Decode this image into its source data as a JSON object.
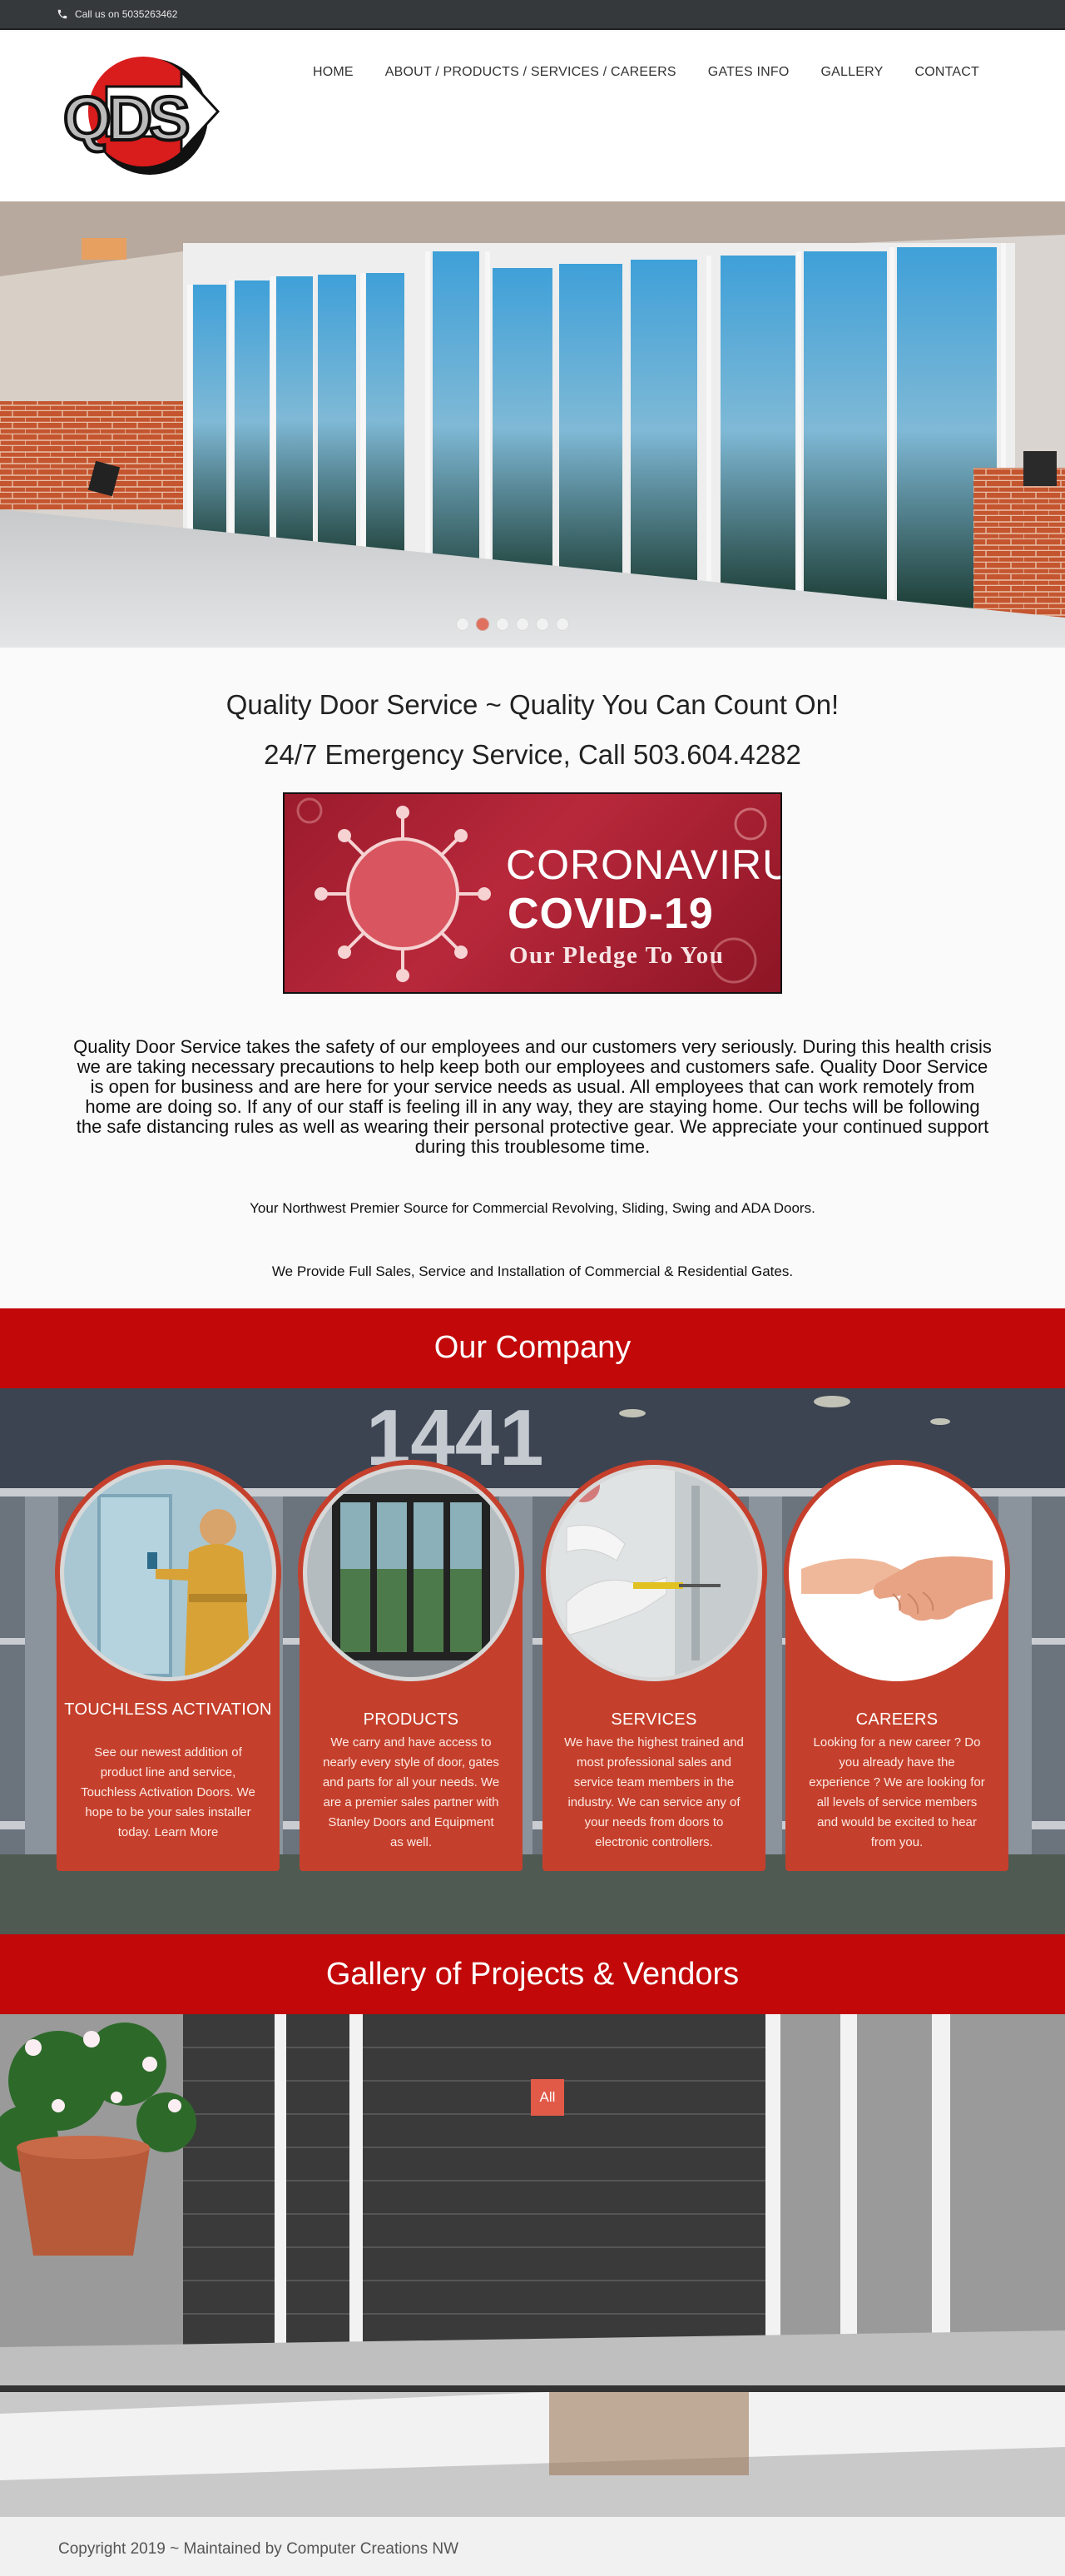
{
  "topbar": {
    "call_label": "Call us on  5035263462",
    "icon": "phone-icon"
  },
  "header": {
    "logo_text": "QDS"
  },
  "nav": {
    "items": [
      {
        "label": "HOME"
      },
      {
        "label": "ABOUT / PRODUCTS / SERVICES / CAREERS"
      },
      {
        "label": "GATES INFO"
      },
      {
        "label": "GALLERY"
      },
      {
        "label": "CONTACT"
      }
    ]
  },
  "hero": {
    "slide_count": 6,
    "active_slide": 2
  },
  "intro": {
    "tagline": "Quality Door Service ~ Quality You Can Count On!",
    "emergency": "24/7 Emergency Service, Call 503.604.4282",
    "covid_banner": {
      "line1": "CORONAVIRUS",
      "line2": "COVID-19",
      "line3": "Our Pledge To You"
    },
    "paragraph": "Quality Door Service takes the safety of our employees and our customers very seriously. During this health crisis we are taking necessary precautions to help keep both our employees and customers safe. Quality Door Service is open for business and are here for your service needs as usual. All employees that can work remotely from home are doing so. If any of our staff is feeling ill in any way, they are staying home. Our techs will be following the safe distancing rules as well as wearing their personal protective gear. We appreciate your continued support during this troublesome time.",
    "source_line": "Your Northwest Premier Source for Commercial Revolving, Sliding, Swing and ADA Doors.",
    "gates_line": "We Provide Full Sales, Service and Installation of Commercial & Residential Gates."
  },
  "company": {
    "heading": "Our Company",
    "cards": [
      {
        "title": "TOUCHLESS ACTIVATION",
        "desc": "See our newest addition of product line and service, Touchless Activation Doors. We hope to be your sales installer today. Learn More"
      },
      {
        "title": "PRODUCTS",
        "desc": "We carry and have access to nearly every style of door, gates and parts for all your needs. We are a premier sales partner with Stanley Doors and Equipment as well."
      },
      {
        "title": "SERVICES",
        "desc": "We have the highest trained and most professional sales and service team members in the industry. We can service any of your needs from doors to electronic controllers."
      },
      {
        "title": "CAREERS",
        "desc": "Looking for a new career ? Do you already have the experience ? We are looking for all levels of service members and would be excited to hear from you."
      }
    ]
  },
  "gallery": {
    "heading": "Gallery of Projects & Vendors",
    "filter_all": "All"
  },
  "footer": {
    "copyright": "Copyright 2019 ~ Maintained by Computer Creations NW"
  },
  "colors": {
    "brand_red": "#c20808",
    "card_red": "#c5402c",
    "topbar": "#35393c"
  }
}
